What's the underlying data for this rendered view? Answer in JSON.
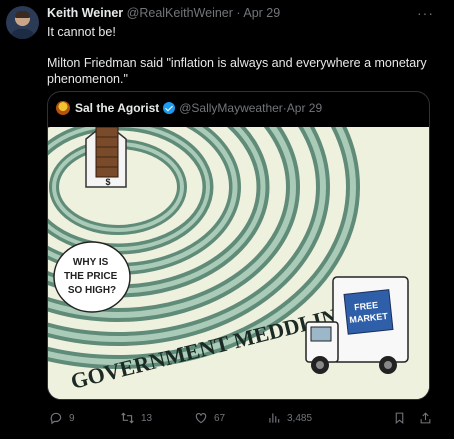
{
  "author": {
    "name": "Keith Weiner",
    "handle": "@RealKeithWeiner",
    "separator": "·",
    "date": "Apr 29"
  },
  "more_label": "···",
  "tweet_text": {
    "line1": "It cannot be!",
    "line2": "Milton Friedman said \"inflation is always and everywhere a monetary phenomenon.\""
  },
  "quoted": {
    "name": "Sal the Agorist",
    "handle": "@SallyMayweather",
    "separator": "·",
    "date": "Apr 29",
    "image": {
      "bubble_text": "WHY IS THE PRICE SO HIGH?",
      "maze_caption": "GOVERNMENT MEDDLING",
      "truck_sign": "FREE MARKET",
      "price_tag": "$"
    }
  },
  "actions": {
    "replies": "9",
    "reposts": "13",
    "likes": "67",
    "views": "3,485"
  },
  "icons": {
    "reply": "reply-icon",
    "repost": "repost-icon",
    "like": "like-icon",
    "views": "views-icon",
    "bookmark": "bookmark-icon",
    "share": "share-icon",
    "verified": "verified-badge-icon"
  },
  "colors": {
    "background": "#000000",
    "text": "#e7e9ea",
    "muted": "#71767b",
    "border": "#2f3336",
    "verified": "#1d9bf0"
  }
}
